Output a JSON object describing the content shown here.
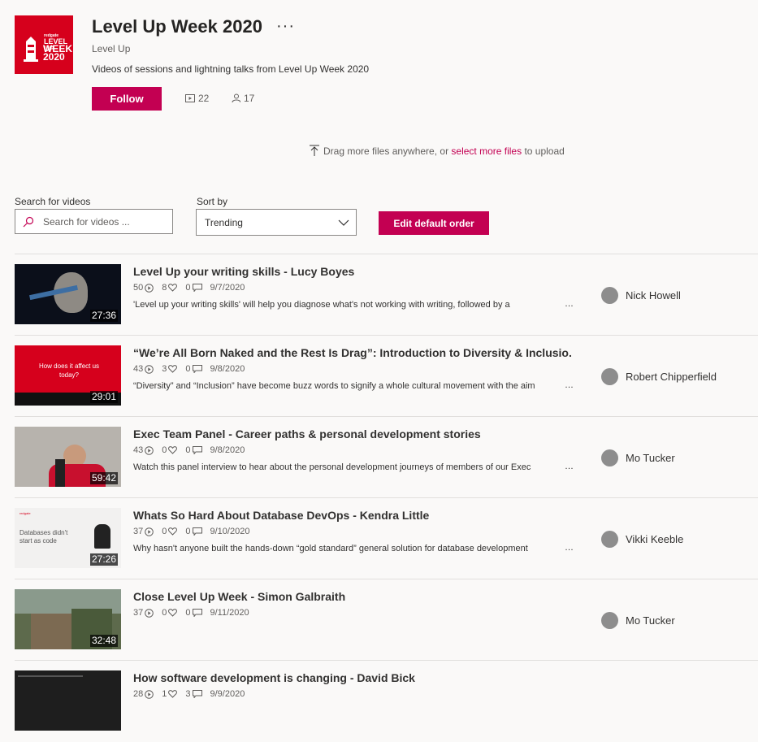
{
  "channel": {
    "logo_text": {
      "top": "redgate",
      "line1": "LEVEL UP",
      "line2": "WEEK",
      "line3": "2020"
    },
    "title": "Level Up Week 2020",
    "more_label": "···",
    "group": "Level Up",
    "description": "Videos of sessions and lightning talks from Level Up Week 2020",
    "follow_label": "Follow",
    "video_count": "22",
    "follower_count": "17",
    "video_count_icon": "video-icon",
    "follower_count_icon": "people-icon"
  },
  "upload": {
    "prefix": "Drag more files anywhere, or ",
    "link": "select more files",
    "suffix": " to upload"
  },
  "controls": {
    "search_label": "Search for videos",
    "search_placeholder": "Search for videos ...",
    "sort_label": "Sort by",
    "sort_value": "Trending",
    "edit_order_label": "Edit default order"
  },
  "videos": [
    {
      "title": "Level Up your writing skills - Lucy Boyes",
      "views": "50",
      "likes": "8",
      "comments": "0",
      "date": "9/7/2020",
      "description": "'Level up your writing skills' will help you diagnose what's not working with writing, followed by a",
      "duration": "27:36",
      "owner": "Nick Howell",
      "thumb_color": "#0b0f1a"
    },
    {
      "title": "“We’re All Born Naked and the Rest Is Drag”: Introduction to Diversity & Inclusio...",
      "views": "43",
      "likes": "3",
      "comments": "0",
      "date": "9/8/2020",
      "description": "“Diversity” and “Inclusion” have become buzz words to signify a whole cultural movement with the aim",
      "duration": "29:01",
      "owner": "Robert Chipperfield",
      "thumb_color": "#d6001c",
      "thumb_text": "How does it affect us today?"
    },
    {
      "title": "Exec Team Panel - Career paths & personal development stories",
      "views": "43",
      "likes": "0",
      "comments": "0",
      "date": "9/8/2020",
      "description": "Watch this panel interview to hear about the personal development journeys of members of our Exec",
      "duration": "59:42",
      "owner": "Mo Tucker",
      "thumb_color": "#b7b3ad"
    },
    {
      "title": "Whats So Hard About Database DevOps - Kendra Little",
      "views": "37",
      "likes": "0",
      "comments": "0",
      "date": "9/10/2020",
      "description": "Why hasn't anyone built the hands-down “gold standard” general solution for database development",
      "duration": "27:26",
      "owner": "Vikki Keeble",
      "thumb_color": "#f2f1f0",
      "thumb_text": "Databases didn't start as code"
    },
    {
      "title": "Close Level Up Week - Simon Galbraith",
      "views": "37",
      "likes": "0",
      "comments": "0",
      "date": "9/11/2020",
      "description": "",
      "duration": "32:48",
      "owner": "Mo Tucker",
      "thumb_color": "#5d6a4c"
    },
    {
      "title": "How software development is changing - David Bick",
      "views": "28",
      "likes": "1",
      "comments": "3",
      "date": "9/9/2020",
      "description": "",
      "duration": "",
      "owner": "",
      "thumb_color": "#1e1e1e"
    }
  ],
  "icons": {
    "views": "play-circle-icon",
    "likes": "heart-icon",
    "comments": "comment-icon",
    "search": "search-icon",
    "sort": "chevron-down-icon",
    "upload": "upload-arrow-icon"
  },
  "colors": {
    "accent": "#c30052",
    "logo_bg": "#d6001c",
    "background": "#faf9f8"
  }
}
